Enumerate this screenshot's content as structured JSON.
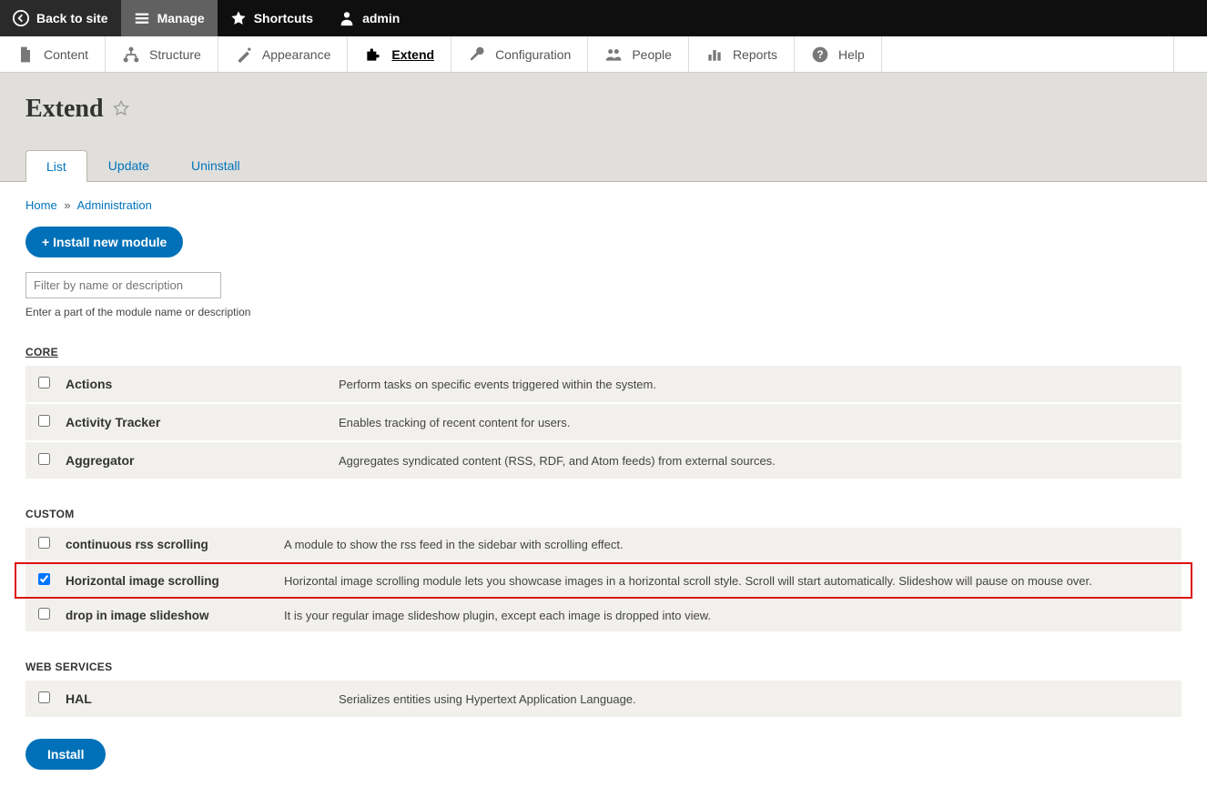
{
  "topbar": {
    "back": "Back to site",
    "manage": "Manage",
    "shortcuts": "Shortcuts",
    "user": "admin"
  },
  "adminmenu": {
    "content": "Content",
    "structure": "Structure",
    "appearance": "Appearance",
    "extend": "Extend",
    "configuration": "Configuration",
    "people": "People",
    "reports": "Reports",
    "help": "Help"
  },
  "page": {
    "title": "Extend"
  },
  "tabs": {
    "list": "List",
    "update": "Update",
    "uninstall": "Uninstall"
  },
  "breadcrumb": {
    "home": "Home",
    "administration": "Administration"
  },
  "buttons": {
    "install_new": "+ Install new module",
    "install": "Install"
  },
  "filter": {
    "placeholder": "Filter by name or description",
    "help": "Enter a part of the module name or description"
  },
  "sections": {
    "core": {
      "title": "CORE",
      "items": [
        {
          "name": "Actions",
          "desc": "Perform tasks on specific events triggered within the system."
        },
        {
          "name": "Activity Tracker",
          "desc": "Enables tracking of recent content for users."
        },
        {
          "name": "Aggregator",
          "desc": "Aggregates syndicated content (RSS, RDF, and Atom feeds) from external sources."
        }
      ]
    },
    "custom": {
      "title": "CUSTOM",
      "items": [
        {
          "name": "continuous rss scrolling",
          "desc": "A module to show the rss feed in the sidebar with scrolling effect.",
          "checked": false,
          "highlight": false
        },
        {
          "name": "Horizontal image scrolling",
          "desc": "Horizontal image scrolling module lets you showcase images in a horizontal scroll style. Scroll will start automatically. Slideshow will pause on mouse over.",
          "checked": true,
          "highlight": true
        },
        {
          "name": "drop in image slideshow",
          "desc": "It is your regular image slideshow plugin, except each image is dropped into view.",
          "checked": false,
          "highlight": false
        }
      ]
    },
    "web_services": {
      "title": "WEB SERVICES",
      "items": [
        {
          "name": "HAL",
          "desc": "Serializes entities using Hypertext Application Language."
        }
      ]
    }
  }
}
